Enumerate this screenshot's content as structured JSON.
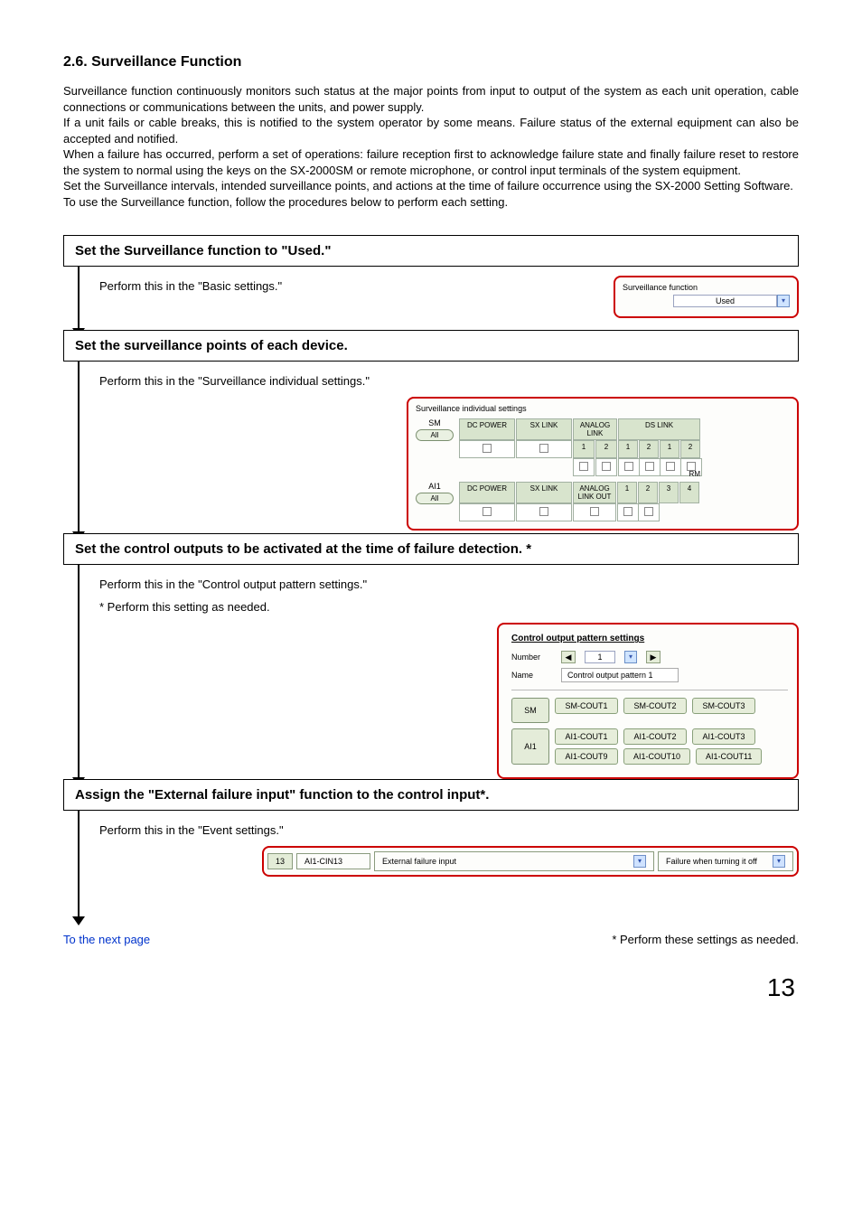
{
  "heading": "2.6. Surveillance Function",
  "paragraphs": [
    "Surveillance function continuously monitors such status at the major points from input to output of the system as each unit operation, cable connections or communications between the units, and power supply.",
    "If a unit fails or cable breaks, this is notified to the system operator by some means. Failure status of the external equipment can also be accepted and notified.",
    "When a failure has occurred, perform a set of operations: failure reception first to acknowledge failure state and finally failure reset to restore the system to normal using the keys on the SX-2000SM or remote microphone, or control input terminals of the system equipment.",
    "Set the Surveillance intervals, intended surveillance points, and actions at the time of failure occurrence using the SX-2000 Setting Software.",
    "To use the Surveillance function, follow the procedures below to perform each setting."
  ],
  "steps": [
    {
      "title": "Set the Surveillance function to \"Used.\"",
      "instruct": "Perform this in the \"Basic settings.\"",
      "fig1": {
        "label": "Surveillance function",
        "value": "Used"
      }
    },
    {
      "title": "Set the surveillance points of each device.",
      "instruct": "Perform this in the \"Surveillance individual settings.\"",
      "fig2": {
        "title": "Surveillance individual settings",
        "rows": [
          {
            "dev": "SM",
            "all": "All",
            "cols1": [
              "DC POWER",
              "SX LINK"
            ],
            "group1": "ANALOG LINK",
            "nums1": [
              "1",
              "2"
            ],
            "group2": "DS LINK",
            "nums2": [
              "1",
              "2",
              "1",
              "2"
            ]
          },
          {
            "dev": "AI1",
            "all": "All",
            "cols1": [
              "DC POWER",
              "SX LINK"
            ],
            "group1": "ANALOG LINK OUT",
            "nums2": [
              "1",
              "2",
              "3",
              "4"
            ],
            "tail": "RM"
          }
        ]
      }
    },
    {
      "title": "Set the control outputs to be activated at the time of failure detection. *",
      "instruct": "Perform this in the \"Control output pattern settings.\"",
      "note": "* Perform this setting as needed.",
      "fig3": {
        "ftitle": "Control output pattern settings",
        "num_label": "Number",
        "num_val": "1",
        "name_label": "Name",
        "name_val": "Control output pattern 1",
        "sm_label": "SM",
        "sm_outputs": [
          "SM-COUT1",
          "SM-COUT2",
          "SM-COUT3"
        ],
        "ai_label": "AI1",
        "ai_rows": [
          [
            "AI1-COUT1",
            "AI1-COUT2",
            "AI1-COUT3"
          ],
          [
            "AI1-COUT9",
            "AI1-COUT10",
            "AI1-COUT11"
          ]
        ]
      }
    },
    {
      "title": "Assign the \"External failure input\" function to the control input*.",
      "instruct": "Perform this in the \"Event settings.\"",
      "fig4": {
        "num": "13",
        "name": "AI1-CIN13",
        "func": "External failure input",
        "opt": "Failure when turning it off"
      }
    }
  ],
  "footer": {
    "left": "To the next page",
    "right": "* Perform these settings as needed."
  },
  "page_num": "13"
}
